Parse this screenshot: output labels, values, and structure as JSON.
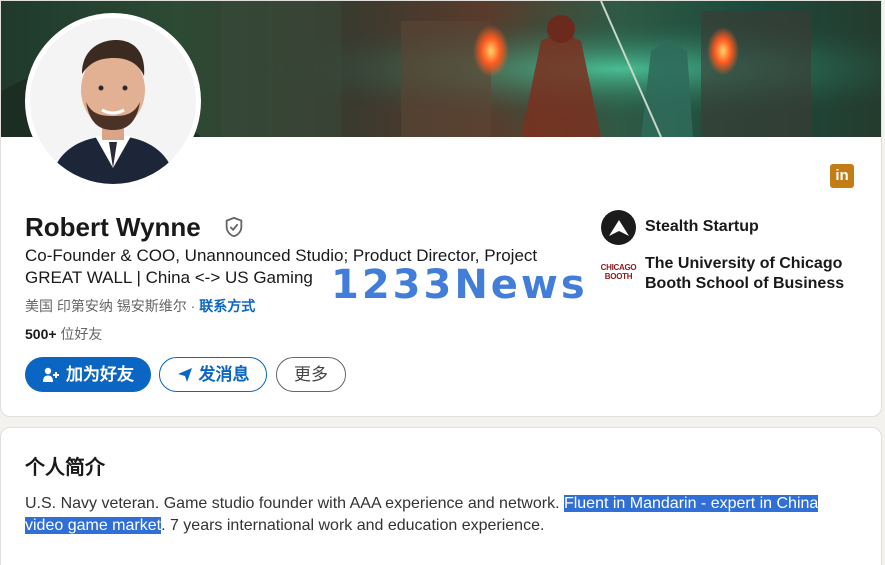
{
  "profile": {
    "name": "Robert Wynne",
    "headline": "Co-Founder & COO, Unannounced Studio; Product Director, Project GREAT WALL | China <-> US Gaming",
    "location": "美国 印第安纳 锡安斯维尔 · ",
    "contact_label": "联系方式",
    "connections_count": "500+",
    "connections_suffix": " 位好友",
    "network_badge": "in"
  },
  "actions": {
    "connect_label": "加为好友",
    "message_label": "发消息",
    "more_label": "更多"
  },
  "experience": [
    {
      "name": "Stealth Startup",
      "icon": "stealth-startup-logo"
    },
    {
      "name": "The University of Chicago Booth School of Business",
      "logo_text": [
        "CHICAGO",
        "BOOTH"
      ],
      "icon": "chicago-booth-logo"
    }
  ],
  "watermark": "1233News",
  "about": {
    "title": "个人简介",
    "text_before": "U.S. Navy veteran. Game studio founder with AAA experience and network. ",
    "text_highlight": "Fluent in Mandarin - expert in China video game market",
    "text_after": ". 7 years international work and education experience."
  },
  "colors": {
    "accent": "#0a66c2",
    "selection": "#2f6fd6",
    "badge": "#c37d16"
  }
}
